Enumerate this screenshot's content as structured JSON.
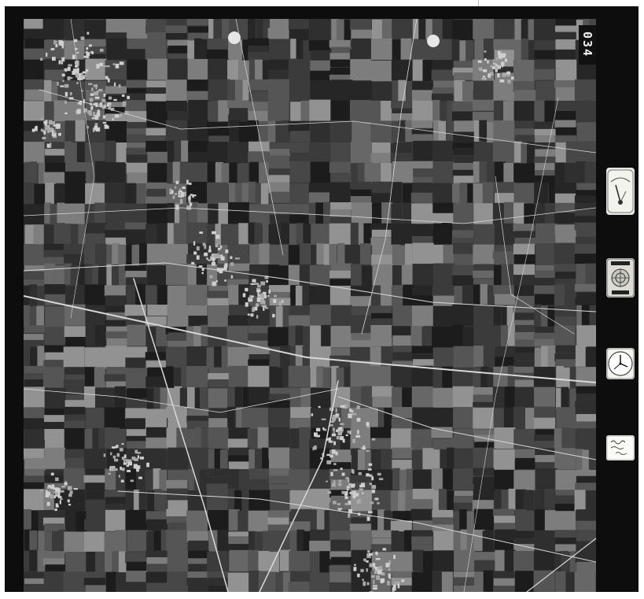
{
  "image": {
    "kind": "aerial survey photograph",
    "tone": "black and white"
  },
  "frame": {
    "number": "034"
  },
  "instruments": {
    "level": {
      "icon": "altimeter-gauge-icon"
    },
    "counter": {
      "icon": "counter-dial-icon"
    },
    "clock": {
      "icon": "clock-icon"
    },
    "note": {
      "icon": "handwritten-note-icon"
    }
  },
  "colors": {
    "frame_border": "#0d0d0d",
    "photo_base": "#3a3a3a",
    "field_light": "#8a8a8a",
    "road": "#d9d9d9",
    "settlement": "#c8c8c8"
  }
}
